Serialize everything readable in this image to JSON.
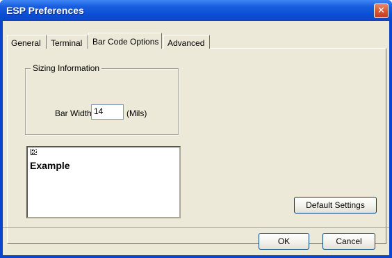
{
  "window": {
    "title": "ESP Preferences",
    "close_glyph": "✕"
  },
  "tabs": [
    {
      "label": "General",
      "active": false
    },
    {
      "label": "Terminal",
      "active": false
    },
    {
      "label": "Bar Code Options",
      "active": true
    },
    {
      "label": "Advanced",
      "active": false
    }
  ],
  "sizing": {
    "group_label": "Sizing Information",
    "bar_width_label": "Bar Width",
    "bar_width_value": "14",
    "units_label": "(Mils)"
  },
  "example": {
    "text": "Example",
    "icon": "barcode-2d-icon"
  },
  "buttons": {
    "default_settings": "Default Settings",
    "ok": "OK",
    "cancel": "Cancel"
  }
}
